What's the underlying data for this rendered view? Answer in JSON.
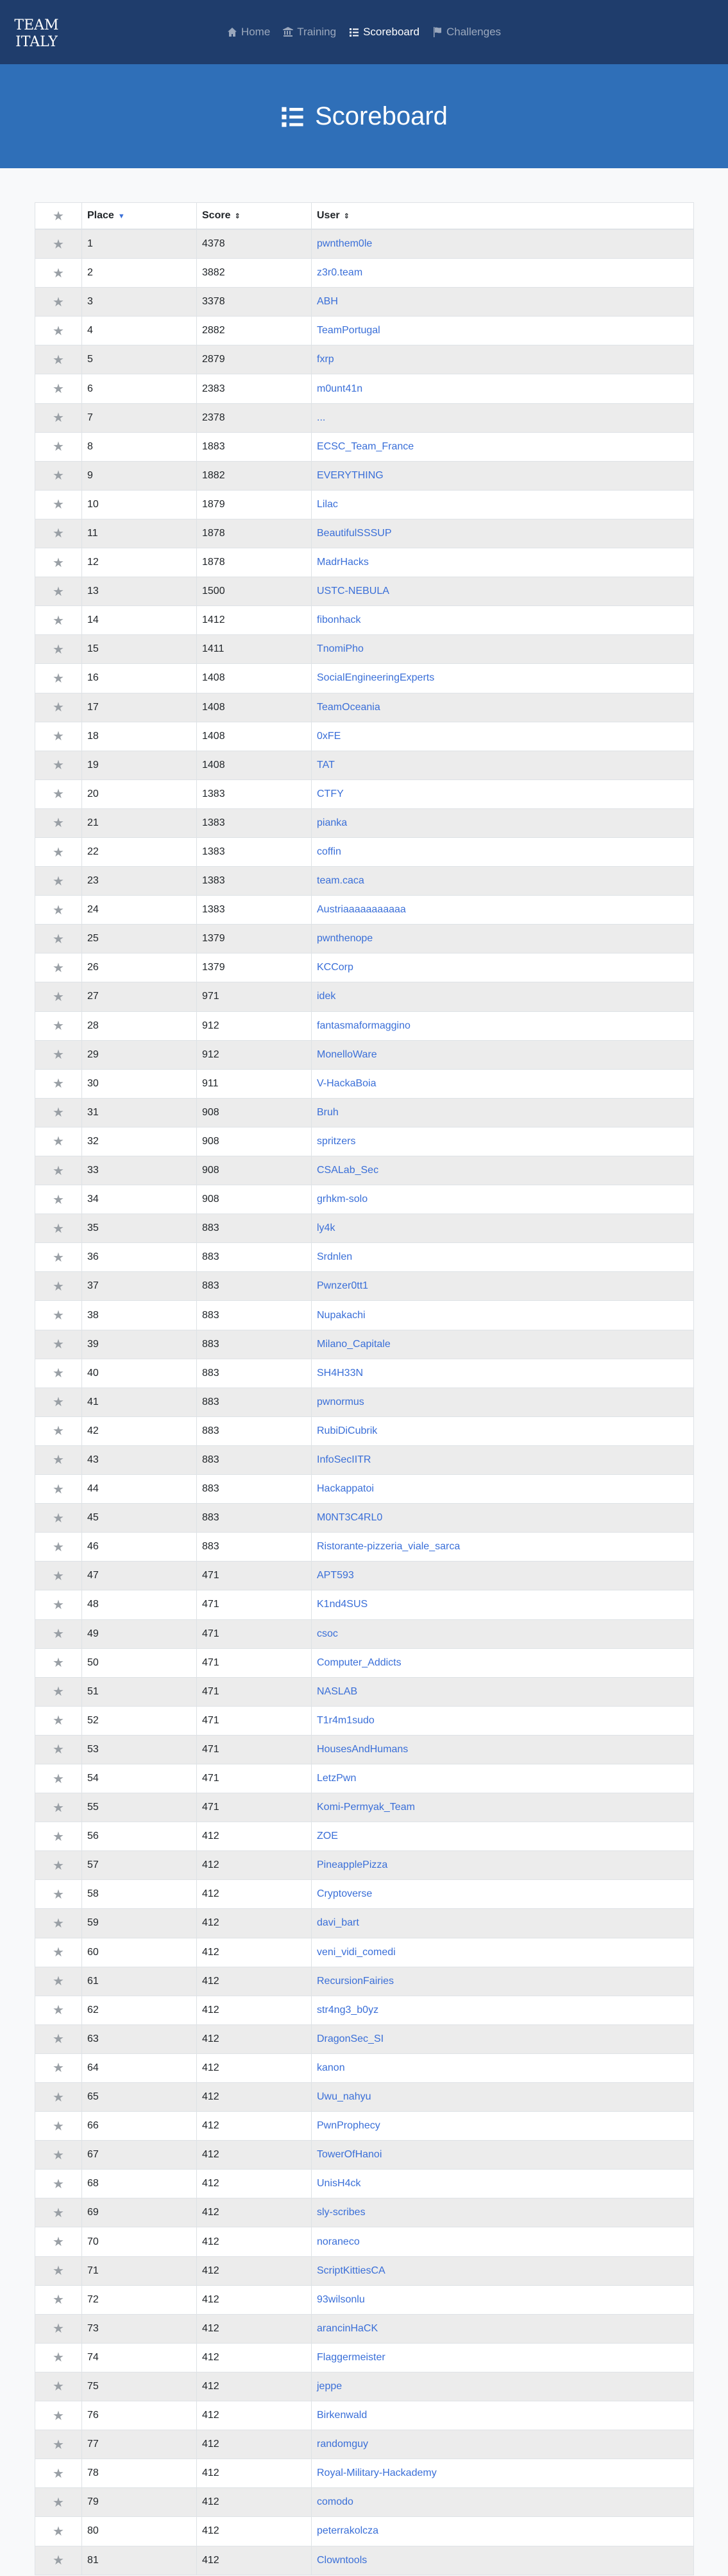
{
  "nav": {
    "logo_lines": [
      "TEAM",
      "ITALY"
    ],
    "home": "Home",
    "training": "Training",
    "scoreboard": "Scoreboard",
    "challenges": "Challenges"
  },
  "hero": {
    "title": "Scoreboard"
  },
  "table": {
    "headers": {
      "place": "Place",
      "score": "Score",
      "user": "User"
    },
    "rows": [
      {
        "place": "1",
        "score": "4378",
        "user": "pwnthem0le"
      },
      {
        "place": "2",
        "score": "3882",
        "user": "z3r0.team"
      },
      {
        "place": "3",
        "score": "3378",
        "user": "ABH"
      },
      {
        "place": "4",
        "score": "2882",
        "user": "TeamPortugal"
      },
      {
        "place": "5",
        "score": "2879",
        "user": "fxrp"
      },
      {
        "place": "6",
        "score": "2383",
        "user": "m0unt41n"
      },
      {
        "place": "7",
        "score": "2378",
        "user": "..."
      },
      {
        "place": "8",
        "score": "1883",
        "user": "ECSC_Team_France"
      },
      {
        "place": "9",
        "score": "1882",
        "user": "EVERYTHING"
      },
      {
        "place": "10",
        "score": "1879",
        "user": "Lilac"
      },
      {
        "place": "11",
        "score": "1878",
        "user": "BeautifulSSSUP"
      },
      {
        "place": "12",
        "score": "1878",
        "user": "MadrHacks"
      },
      {
        "place": "13",
        "score": "1500",
        "user": "USTC-NEBULA"
      },
      {
        "place": "14",
        "score": "1412",
        "user": "fibonhack"
      },
      {
        "place": "15",
        "score": "1411",
        "user": "TnomiPho"
      },
      {
        "place": "16",
        "score": "1408",
        "user": "SocialEngineeringExperts"
      },
      {
        "place": "17",
        "score": "1408",
        "user": "TeamOceania"
      },
      {
        "place": "18",
        "score": "1408",
        "user": "0xFE"
      },
      {
        "place": "19",
        "score": "1408",
        "user": "TAT"
      },
      {
        "place": "20",
        "score": "1383",
        "user": "CTFY"
      },
      {
        "place": "21",
        "score": "1383",
        "user": "pianka"
      },
      {
        "place": "22",
        "score": "1383",
        "user": "coffin"
      },
      {
        "place": "23",
        "score": "1383",
        "user": "team.caca"
      },
      {
        "place": "24",
        "score": "1383",
        "user": "Austriaaaaaaaaaaa"
      },
      {
        "place": "25",
        "score": "1379",
        "user": "pwnthenope"
      },
      {
        "place": "26",
        "score": "1379",
        "user": "KCCorp"
      },
      {
        "place": "27",
        "score": "971",
        "user": "idek"
      },
      {
        "place": "28",
        "score": "912",
        "user": "fantasmaformaggino"
      },
      {
        "place": "29",
        "score": "912",
        "user": "MonelloWare"
      },
      {
        "place": "30",
        "score": "911",
        "user": "V-HackaBoia"
      },
      {
        "place": "31",
        "score": "908",
        "user": "Bruh"
      },
      {
        "place": "32",
        "score": "908",
        "user": "spritzers"
      },
      {
        "place": "33",
        "score": "908",
        "user": "CSALab_Sec"
      },
      {
        "place": "34",
        "score": "908",
        "user": "grhkm-solo"
      },
      {
        "place": "35",
        "score": "883",
        "user": "ly4k"
      },
      {
        "place": "36",
        "score": "883",
        "user": "Srdnlen"
      },
      {
        "place": "37",
        "score": "883",
        "user": "Pwnzer0tt1"
      },
      {
        "place": "38",
        "score": "883",
        "user": "Nupakachi"
      },
      {
        "place": "39",
        "score": "883",
        "user": "Milano_Capitale"
      },
      {
        "place": "40",
        "score": "883",
        "user": "SH4H33N"
      },
      {
        "place": "41",
        "score": "883",
        "user": "pwnormus"
      },
      {
        "place": "42",
        "score": "883",
        "user": "RubiDiCubrik"
      },
      {
        "place": "43",
        "score": "883",
        "user": "InfoSecIITR"
      },
      {
        "place": "44",
        "score": "883",
        "user": "Hackappatoi"
      },
      {
        "place": "45",
        "score": "883",
        "user": "M0NT3C4RL0"
      },
      {
        "place": "46",
        "score": "883",
        "user": "Ristorante-pizzeria_viale_sarca"
      },
      {
        "place": "47",
        "score": "471",
        "user": "APT593"
      },
      {
        "place": "48",
        "score": "471",
        "user": "K1nd4SUS"
      },
      {
        "place": "49",
        "score": "471",
        "user": "csoc"
      },
      {
        "place": "50",
        "score": "471",
        "user": "Computer_Addicts"
      },
      {
        "place": "51",
        "score": "471",
        "user": "NASLAB"
      },
      {
        "place": "52",
        "score": "471",
        "user": "T1r4m1sudo"
      },
      {
        "place": "53",
        "score": "471",
        "user": "HousesAndHumans"
      },
      {
        "place": "54",
        "score": "471",
        "user": "LetzPwn"
      },
      {
        "place": "55",
        "score": "471",
        "user": "Komi-Permyak_Team"
      },
      {
        "place": "56",
        "score": "412",
        "user": "ZOE"
      },
      {
        "place": "57",
        "score": "412",
        "user": "PineapplePizza"
      },
      {
        "place": "58",
        "score": "412",
        "user": "Cryptoverse"
      },
      {
        "place": "59",
        "score": "412",
        "user": "davi_bart"
      },
      {
        "place": "60",
        "score": "412",
        "user": "veni_vidi_comedi"
      },
      {
        "place": "61",
        "score": "412",
        "user": "RecursionFairies"
      },
      {
        "place": "62",
        "score": "412",
        "user": "str4ng3_b0yz"
      },
      {
        "place": "63",
        "score": "412",
        "user": "DragonSec_SI"
      },
      {
        "place": "64",
        "score": "412",
        "user": "kanon"
      },
      {
        "place": "65",
        "score": "412",
        "user": "Uwu_nahyu"
      },
      {
        "place": "66",
        "score": "412",
        "user": "PwnProphecy"
      },
      {
        "place": "67",
        "score": "412",
        "user": "TowerOfHanoi"
      },
      {
        "place": "68",
        "score": "412",
        "user": "UnisH4ck"
      },
      {
        "place": "69",
        "score": "412",
        "user": "sly-scribes"
      },
      {
        "place": "70",
        "score": "412",
        "user": "noraneco"
      },
      {
        "place": "71",
        "score": "412",
        "user": "ScriptKittiesCA"
      },
      {
        "place": "72",
        "score": "412",
        "user": "93wilsonlu"
      },
      {
        "place": "73",
        "score": "412",
        "user": "arancinHaCK"
      },
      {
        "place": "74",
        "score": "412",
        "user": "Flaggermeister"
      },
      {
        "place": "75",
        "score": "412",
        "user": "jeppe"
      },
      {
        "place": "76",
        "score": "412",
        "user": "Birkenwald"
      },
      {
        "place": "77",
        "score": "412",
        "user": "randomguy"
      },
      {
        "place": "78",
        "score": "412",
        "user": "Royal-Military-Hackademy"
      },
      {
        "place": "79",
        "score": "412",
        "user": "comodo"
      },
      {
        "place": "80",
        "score": "412",
        "user": "peterrakolcza"
      },
      {
        "place": "81",
        "score": "412",
        "user": "Clowntools"
      }
    ]
  },
  "colors": {
    "navbar": "#1f3d6c",
    "hero": "#2f6fb8",
    "link": "#3a6fd8",
    "stripe": "#ececec"
  },
  "icons": {
    "star": "star-icon",
    "home": "home-icon",
    "training": "bank-icon",
    "scoreboard": "list-icon",
    "challenges": "flag-icon"
  }
}
